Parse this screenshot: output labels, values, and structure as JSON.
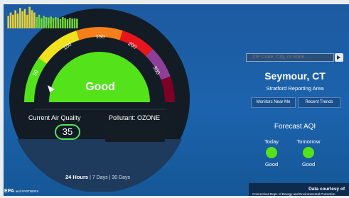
{
  "gauge": {
    "status": "Good",
    "scale_labels": [
      "50",
      "100",
      "150",
      "200",
      "300"
    ],
    "current_label": "Current Air Quality",
    "aqi_value": "35",
    "pollutant_label": "Pollutant: OZONE"
  },
  "history": {
    "selected": "24 Hours",
    "sep": "|",
    "options": [
      "7 Days",
      "30 Days"
    ],
    "bar_heights": [
      0.55,
      0.7,
      0.6,
      0.8,
      0.65,
      0.9,
      0.75,
      0.85,
      0.6,
      0.95,
      0.8,
      0.7,
      0.5,
      0.6,
      0.45,
      0.55,
      0.5,
      0.48,
      0.52,
      0.45,
      0.5,
      0.46,
      0.42,
      0.5,
      0.45,
      0.4,
      0.46,
      0.43,
      0.44,
      0.42
    ]
  },
  "search": {
    "placeholder": "ZIP Code, City, or State"
  },
  "location": {
    "city": "Seymour, CT",
    "reporting_area": "Stratford Reporting Area"
  },
  "buttons": {
    "monitors": "Monitors Near Me",
    "trends": "Recent Trends"
  },
  "forecast": {
    "title": "Forecast AQI",
    "days": [
      {
        "label": "Today",
        "category": "Good"
      },
      {
        "label": "Tomorrow",
        "category": "Good"
      }
    ]
  },
  "footer": {
    "logo": "EPA",
    "logo_sub": "and PARTNERS",
    "courtesy_title": "Data courtesy of",
    "courtesy_text": "Connecticut Dept. of Energy and Environmental Protection"
  },
  "colors": {
    "good": "#54e21b",
    "moderate": "#f0e21e",
    "usg": "#f5801b",
    "unhealthy": "#e8151c",
    "very_unhealthy": "#8f3f97",
    "hazardous": "#7e0023",
    "bar_yellow": "#e9d33a",
    "bar_green": "#72d83a"
  }
}
